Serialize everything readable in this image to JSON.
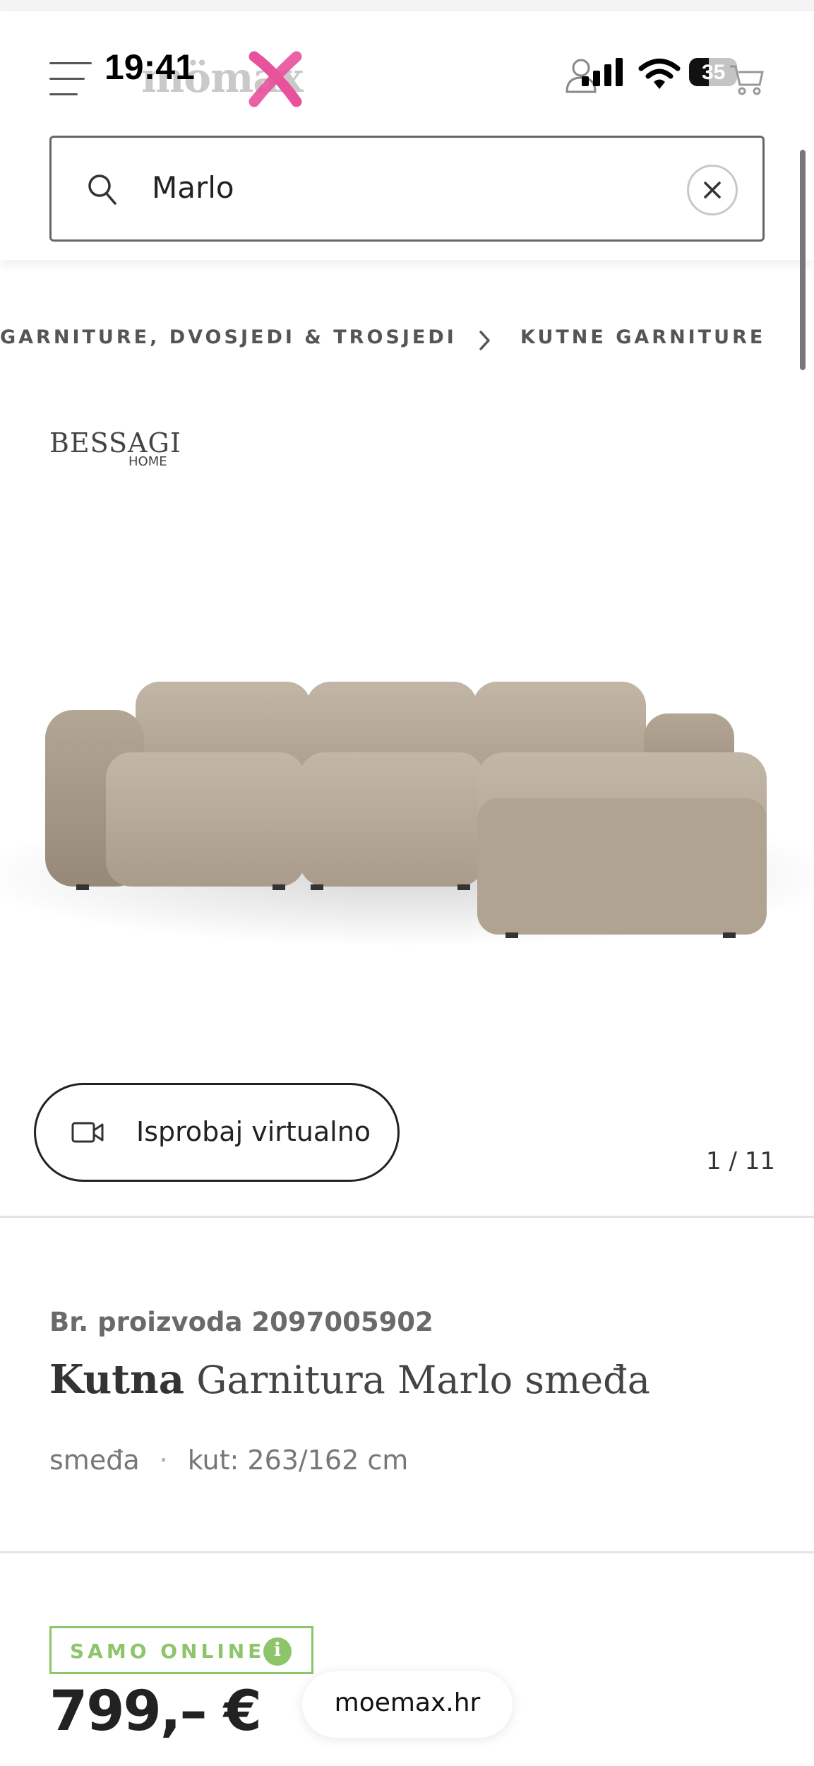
{
  "status_bar": {
    "time": "19:41",
    "battery": "35",
    "icons": [
      "signal-icon",
      "wifi-icon",
      "battery-icon"
    ]
  },
  "header": {
    "logo_text": "mömax",
    "icons": [
      "hamburger-menu-icon",
      "user-icon",
      "cart-icon"
    ]
  },
  "search": {
    "value": "Marlo",
    "clear_icon": "close-icon"
  },
  "breadcrumb": {
    "items": [
      "GARNITURE, DVOSJEDI & TROSJEDI",
      "KUTNE GARNITURE"
    ]
  },
  "brand": {
    "name": "BESSAGI",
    "subline": "HOME"
  },
  "gallery": {
    "virtual_button_label": "Isprobaj virtualno",
    "counter": "1 / 11"
  },
  "product": {
    "number": "Br. proizvoda 2097005902",
    "title_bold": "Kutna",
    "title_rest": " Garnitura Marlo smeđa",
    "color": "smeđa",
    "separator": "·",
    "dimensions": "kut: 263/162 cm"
  },
  "pricing": {
    "badge": "SAMO ONLINE",
    "info_glyph": "i",
    "price": "799,– €"
  },
  "browser": {
    "url": "moemax.hr"
  },
  "colors": {
    "accent_pink": "#e8519b",
    "online_green": "#8dc56a",
    "sofa_fabric": "#b7aa99"
  }
}
